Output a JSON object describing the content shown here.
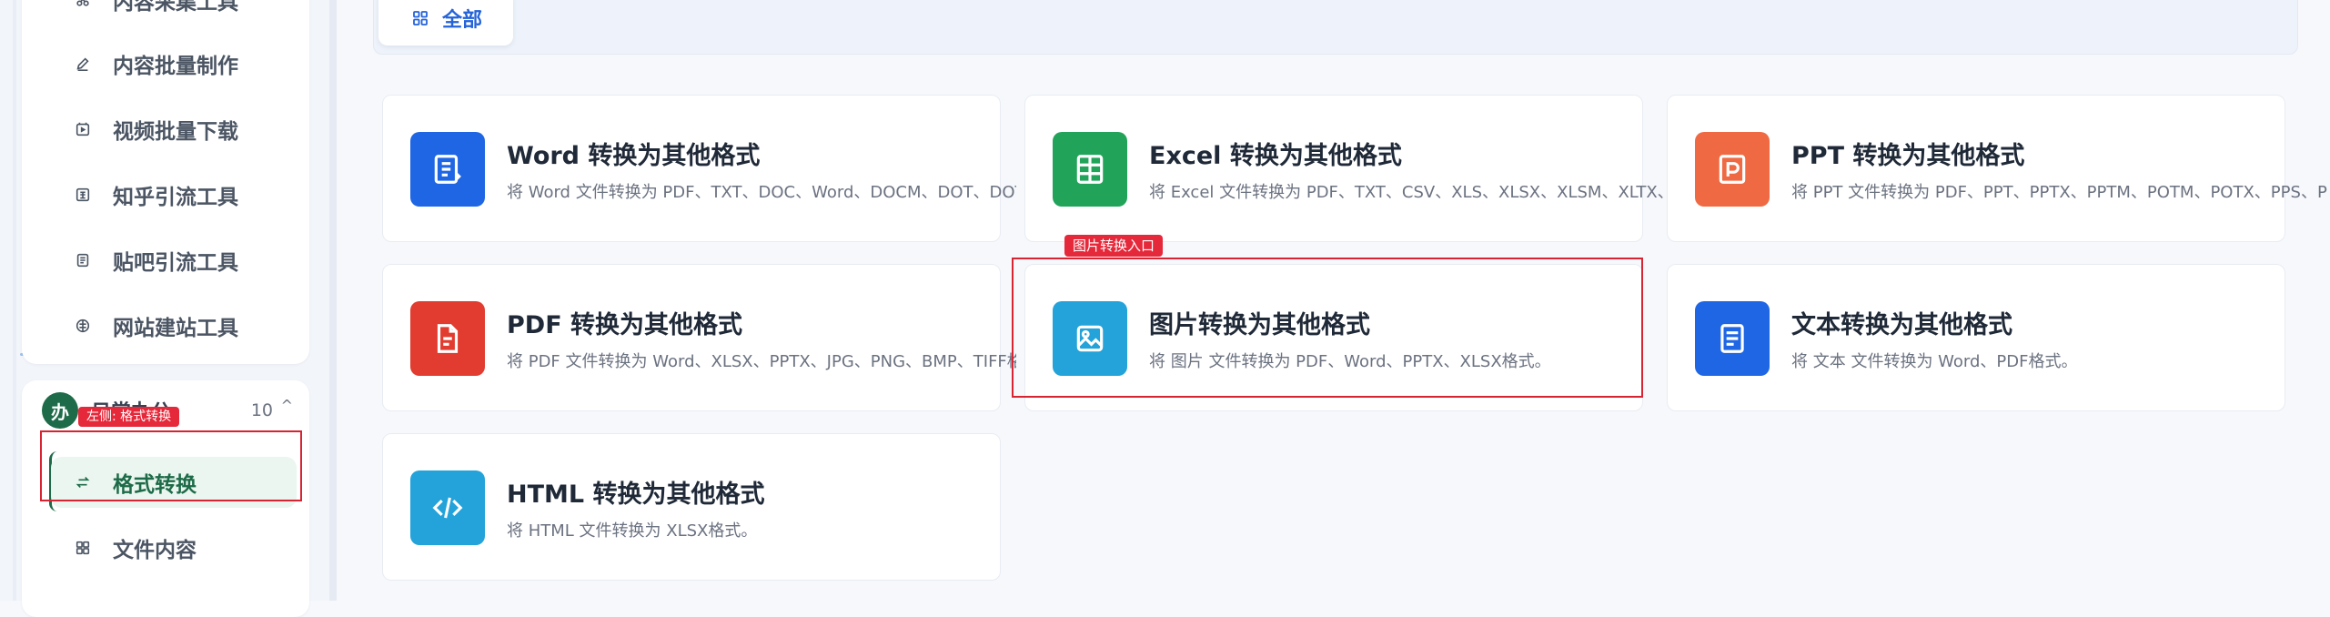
{
  "sidebar": {
    "items": [
      {
        "label": "内容采集工具",
        "icon": "scissors-icon"
      },
      {
        "label": "内容批量制作",
        "icon": "pencil-icon"
      },
      {
        "label": "视频批量下载",
        "icon": "video-icon"
      },
      {
        "label": "知乎引流工具",
        "icon": "zhihu-icon"
      },
      {
        "label": "贴吧引流工具",
        "icon": "tieba-icon"
      },
      {
        "label": "网站建站工具",
        "icon": "globe-icon"
      }
    ],
    "group": {
      "avatar": "办",
      "title": "日常办公",
      "count": "10",
      "caret": "^"
    },
    "group_items": [
      {
        "label": "格式转换",
        "icon": "swap-icon",
        "active": true
      },
      {
        "label": "文件内容",
        "icon": "grid-icon",
        "active": false
      }
    ],
    "annotation": "左侧: 格式转换"
  },
  "filter": {
    "all_label": "全部"
  },
  "cards": [
    {
      "title": "Word 转换为其他格式",
      "desc": "将 Word 文件转换为 PDF、TXT、DOC、Word、DOCM、DOT、DOTX",
      "color": "#1f66e5",
      "icon": "document-icon"
    },
    {
      "title": "Excel 转换为其他格式",
      "desc": "将 Excel 文件转换为 PDF、TXT、CSV、XLS、XLSX、XLSM、XLTX、XLTM",
      "color": "#22a35a",
      "icon": "spreadsheet-icon"
    },
    {
      "title": "PPT 转换为其他格式",
      "desc": "将 PPT 文件转换为 PDF、PPT、PPTX、PPTM、POTM、POTX、PPS、PPSX",
      "color": "#ef6a43",
      "icon": "presentation-icon"
    },
    {
      "title": "PDF 转换为其他格式",
      "desc": "将 PDF 文件转换为 Word、XLSX、PPTX、JPG、PNG、BMP、TIFF格式。",
      "color": "#e23b2f",
      "icon": "pdf-icon"
    },
    {
      "title": "图片转换为其他格式",
      "desc": "将 图片 文件转换为 PDF、Word、PPTX、XLSX格式。",
      "color": "#23a3d9",
      "icon": "image-icon"
    },
    {
      "title": "文本转换为其他格式",
      "desc": "将 文本 文件转换为 Word、PDF格式。",
      "color": "#1f66e5",
      "icon": "text-icon"
    },
    {
      "title": "HTML 转换为其他格式",
      "desc": "将 HTML 文件转换为 XLSX格式。",
      "color": "#23a3d9",
      "icon": "code-icon"
    }
  ],
  "image_annotation": "图片转换入口"
}
